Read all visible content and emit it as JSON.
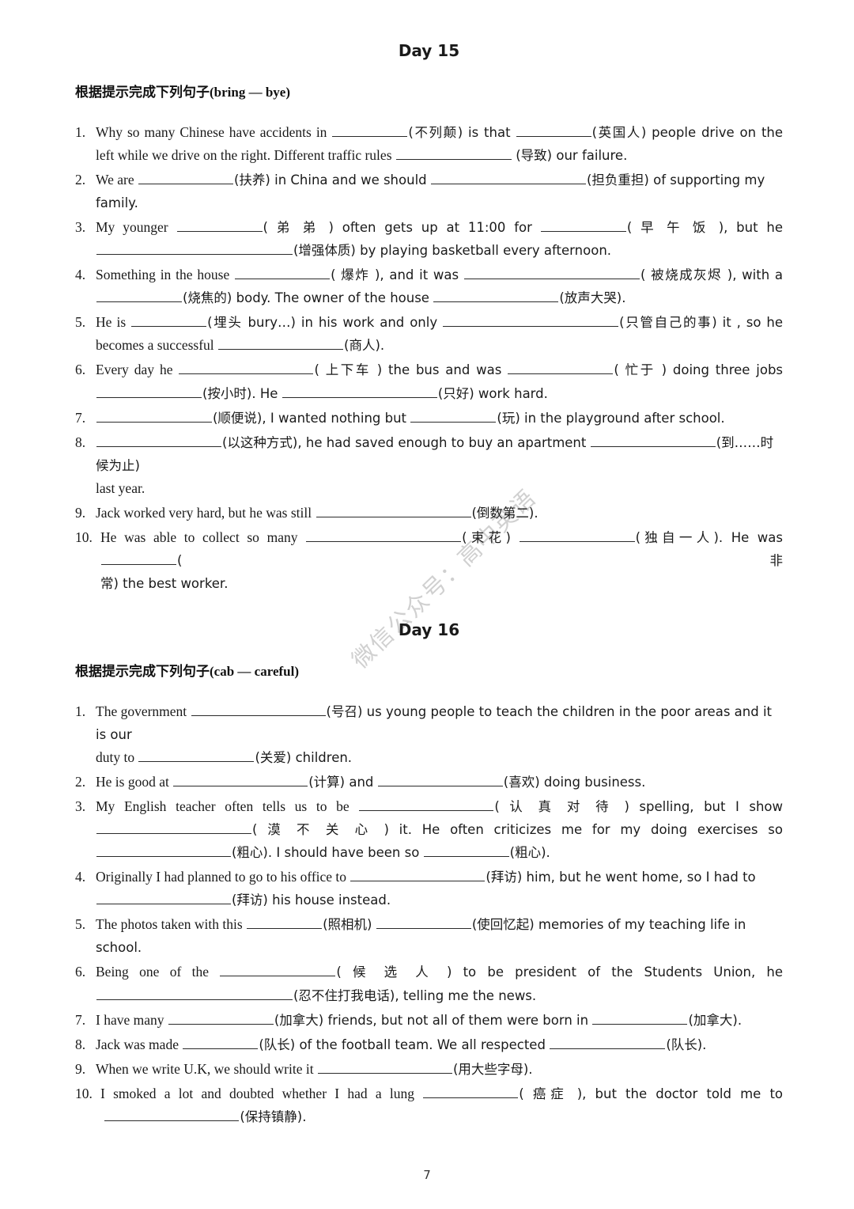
{
  "page": {
    "number": "7",
    "watermark": "微信公众号：高中英语"
  },
  "sections": [
    {
      "title": "Day 15",
      "heading_cn": "根据提示完成下列句子",
      "heading_range": "(bring — bye)",
      "questions": [
        {
          "number": "1.",
          "lines": [
            "Why so many Chinese have accidents in ____(不列颠) is that ____(英国人) people drive on the",
            "left while we drive on the right. Different traffic rules ____ (导致) our failure."
          ]
        },
        {
          "number": "2.",
          "lines": [
            "We are ____(扶养) in China and we should ____(担负重担) of supporting my family."
          ]
        },
        {
          "number": "3.",
          "lines": [
            "My younger ____( 弟 弟 ) often gets up at 11:00 for ____( 早 午 饭 ), but he",
            "____(增强体质) by playing basketball every afternoon."
          ]
        },
        {
          "number": "4.",
          "lines": [
            "Something in the house ____( 爆炸 ), and it was ____( 被烧成灰烬 ), with a",
            "____(烧焦的) body. The owner of the house ____(放声大哭)."
          ]
        },
        {
          "number": "5.",
          "lines": [
            "He is ____(埋头 bury…) in his work and only ____(只管自己的事) it , so he",
            "becomes a successful ____(商人)."
          ]
        },
        {
          "number": "6.",
          "lines": [
            "Every day he ____( 上下车 ) the bus and was ____( 忙于 ) doing three jobs",
            "____(按小时). He ____(只好) work hard."
          ]
        },
        {
          "number": "7.",
          "lines": [
            "____(顺便说), I wanted nothing but ____(玩) in the playground after school."
          ]
        },
        {
          "number": "8.",
          "lines": [
            "____(以这种方式), he had saved enough to buy an apartment ____(到……时候为止)",
            "last year."
          ]
        },
        {
          "number": "9.",
          "lines": [
            "Jack worked very hard, but he was still ____(倒数第二)."
          ]
        },
        {
          "number": "10.",
          "lines": [
            "He was able to collect so many ____(束花) ____(独自一人). He was ____(非",
            "常) the best worker."
          ]
        }
      ]
    },
    {
      "title": "Day 16",
      "heading_cn": "根据提示完成下列句子",
      "heading_range": "(cab — careful)",
      "questions": [
        {
          "number": "1.",
          "lines": [
            "The government ____(号召) us young people to teach the children in the poor areas and it is our",
            "duty to ____(关爱) children."
          ]
        },
        {
          "number": "2.",
          "lines": [
            "He is good at ____(计算) and ____(喜欢) doing business."
          ]
        },
        {
          "number": "3.",
          "lines": [
            "My English teacher often tells us to be ____( 认 真 对 待 ) spelling, but I show",
            "____( 漠 不 关 心 ) it. He often criticizes me for my doing exercises so",
            "____(粗心). I should have been so ____(粗心)."
          ]
        },
        {
          "number": "4.",
          "lines": [
            "Originally I had planned to go to his office to ____(拜访) him, but he went home, so I had to",
            "____(拜访) his house instead."
          ]
        },
        {
          "number": "5.",
          "lines": [
            "The photos taken with this ____(照相机) ____(使回忆起) memories of my teaching life in school."
          ]
        },
        {
          "number": "6.",
          "lines": [
            "Being one of the ____( 候 选 人 ) to be president of the Students Union, he",
            "____(忍不住打我电话), telling me the news."
          ]
        },
        {
          "number": "7.",
          "lines": [
            "I have many ____(加拿大) friends, but not all of them were born in ____(加拿大)."
          ]
        },
        {
          "number": "8.",
          "lines": [
            "Jack was made ____(队长) of the football team. We all respected ____(队长)."
          ]
        },
        {
          "number": "9.",
          "lines": [
            "When we write U.K, we should write it ____(用大些字母)."
          ]
        },
        {
          "number": "10.",
          "lines": [
            "I smoked a lot and doubted whether I had a lung ____( 癌症 ), but the doctor told me to",
            "____(保持镇静)."
          ]
        }
      ]
    }
  ],
  "q": {
    "d15": {
      "q1a": "Why so many Chinese have accidents in",
      "q1b": "(不列颠) is that",
      "q1c": "(英国人) people drive on the",
      "q1d": "left while we drive on the right. Different traffic rules",
      "q1e": "(导致) our failure.",
      "q2a": "We are",
      "q2b": "(扶养) in China and we should",
      "q2c": "(担负重担) of supporting my family.",
      "q3a": "My   younger",
      "q3b": "( 弟 弟 )  often  gets  up  at  11:00  for",
      "q3c": "( 早 午 饭 ),  but  he",
      "q3d": "(增强体质) by playing basketball every afternoon.",
      "q4a": "Something in the house",
      "q4b": "( 爆炸 ), and it was",
      "q4c": "( 被烧成灰烬 ), with a",
      "q4d": "(烧焦的) body. The owner of the house",
      "q4e": "(放声大哭).",
      "q5a": "He is",
      "q5b": "(埋头 bury…) in his work and only",
      "q5c": "(只管自己的事) it , so he",
      "q5d": "becomes a successful",
      "q5e": "(商人).",
      "q6a": "Every  day  he",
      "q6b": "( 上下车 )  the  bus  and  was",
      "q6c": "( 忙于 )  doing  three  jobs",
      "q6d": "(按小时). He",
      "q6e": "(只好) work hard.",
      "q7a": "(顺便说), I wanted nothing but",
      "q7b": "(玩) in the playground after school.",
      "q8a": "(以这种方式), he had saved enough to buy an apartment",
      "q8b": "(到……时候为止)",
      "q8c": "last year.",
      "q9a": "Jack worked very hard, but he was still",
      "q9b": "(倒数第二).",
      "q10a": "He was able to collect so many",
      "q10b": "(束花)",
      "q10c": "(独自一人). He was",
      "q10d": "(非",
      "q10e": "常) the best worker."
    },
    "d16": {
      "q1a": "The government",
      "q1b": "(号召) us young people to teach the children in the poor areas and it is our",
      "q1c": "duty to",
      "q1d": "(关爱) children.",
      "q2a": "He is good at",
      "q2b": "(计算) and",
      "q2c": "(喜欢) doing business.",
      "q3a": "My  English  teacher  often  tells  us  to  be",
      "q3b": "( 认 真 对 待 )  spelling,  but  I  show",
      "q3c": "( 漠 不 关 心 )  it.  He  often  criticizes  me  for  my  doing  exercises  so",
      "q3d": "(粗心). I should have been so",
      "q3e": "(粗心).",
      "q4a": "Originally I had planned to go to his office to",
      "q4b": "(拜访) him, but he went home, so I had to",
      "q4c": "(拜访) his house instead.",
      "q5a": "The photos taken with this",
      "q5b": "(照相机)",
      "q5c": "(使回忆起) memories of my teaching life in school.",
      "q6a": "Being  one  of  the",
      "q6b": "( 候 选 人 )  to  be  president  of  the  Students  Union,  he",
      "q6c": "(忍不住打我电话), telling me the news.",
      "q7a": "I have many",
      "q7b": "(加拿大) friends, but not all of them were born in",
      "q7c": "(加拿大).",
      "q8a": "Jack was made",
      "q8b": "(队长) of the football team. We all respected",
      "q8c": "(队长).",
      "q9a": "When we write U.K, we should write it",
      "q9b": "(用大些字母).",
      "q10a": "I  smoked  a  lot  and  doubted  whether  I  had  a  lung",
      "q10b": "( 癌症 ),  but  the  doctor  told  me  to",
      "q10c": "(保持镇静)."
    }
  }
}
